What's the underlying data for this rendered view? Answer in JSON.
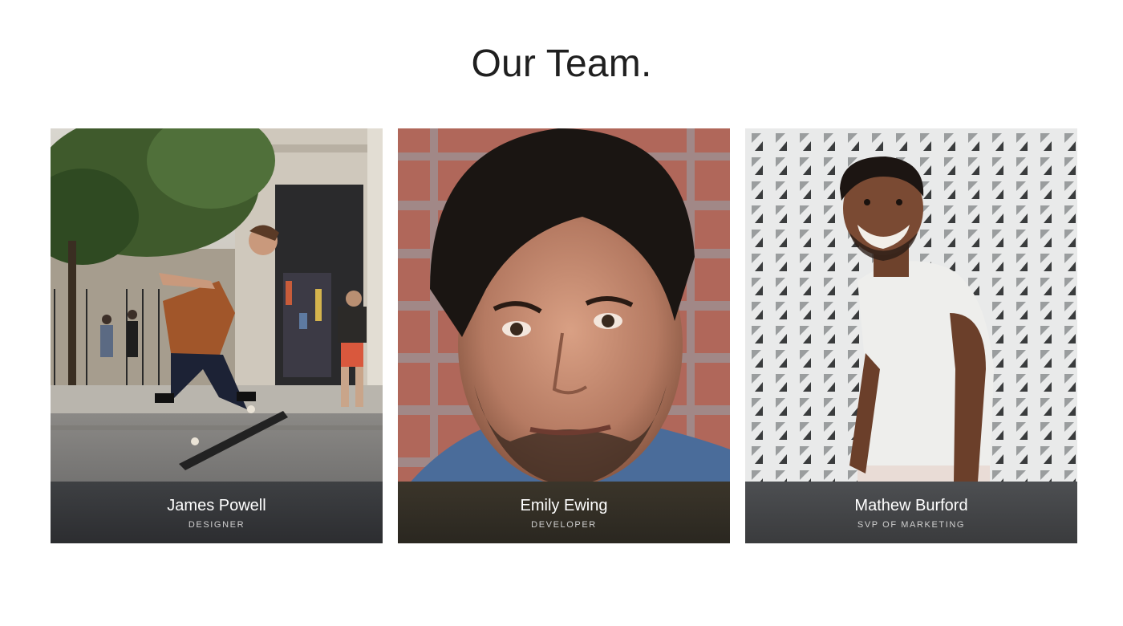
{
  "heading": "Our Team.",
  "members": [
    {
      "name": "James Powell",
      "role": "DESIGNER",
      "photo": "skateboarder-photo"
    },
    {
      "name": "Emily Ewing",
      "role": "DEVELOPER",
      "photo": "portrait-photo"
    },
    {
      "name": "Mathew Burford",
      "role": "SVP OF MARKETING",
      "photo": "smiling-man-photo"
    }
  ]
}
